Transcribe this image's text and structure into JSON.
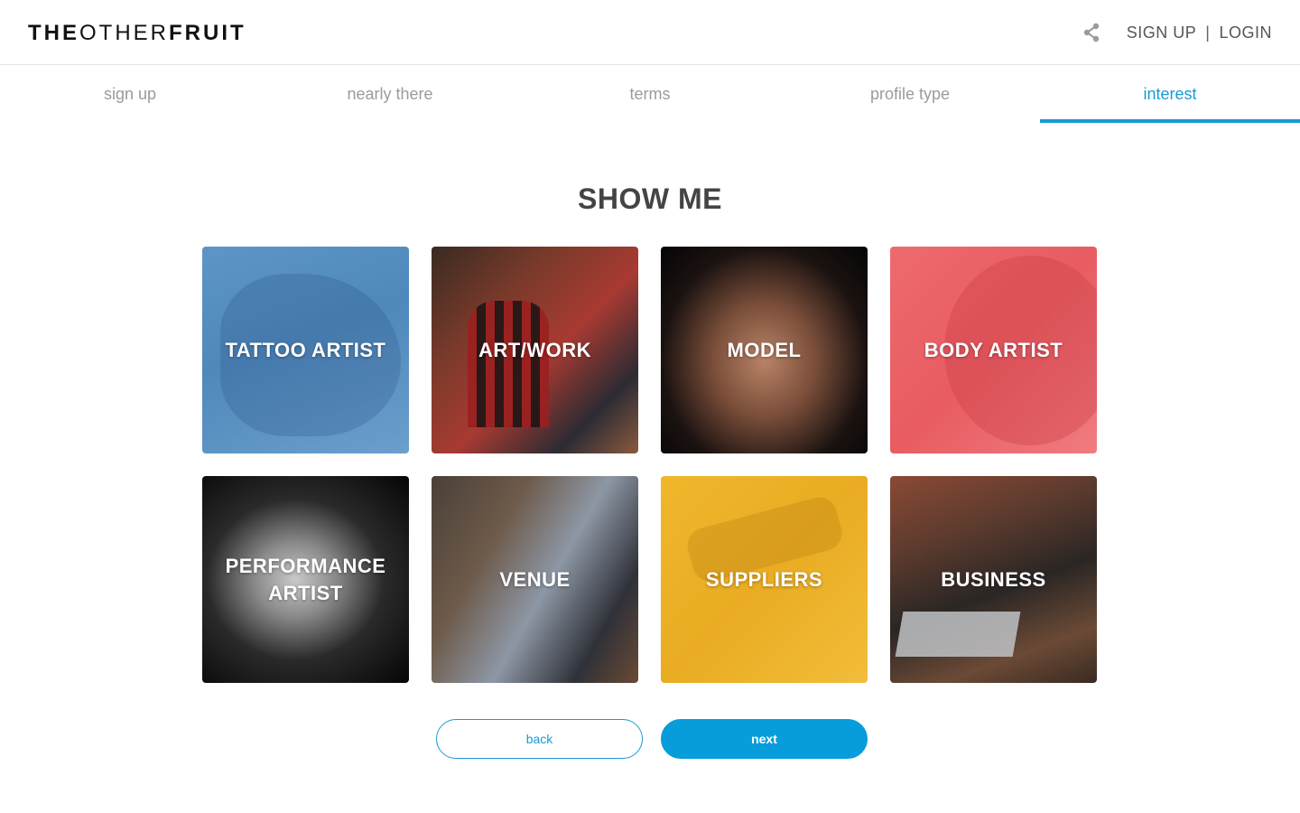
{
  "header": {
    "logo": {
      "part1": "THE",
      "part2": "OTHER",
      "part3": "FRUIT"
    },
    "share_icon": "share-icon",
    "signup_label": "SIGN UP",
    "separator": "|",
    "login_label": "LOGIN"
  },
  "steps": [
    {
      "label": "sign up",
      "active": false
    },
    {
      "label": "nearly there",
      "active": false
    },
    {
      "label": "terms",
      "active": false
    },
    {
      "label": "profile type",
      "active": false
    },
    {
      "label": "interest",
      "active": true
    }
  ],
  "main": {
    "title": "SHOW ME",
    "tiles": [
      {
        "label": "TATTOO ARTIST"
      },
      {
        "label": "ART/WORK"
      },
      {
        "label": "MODEL"
      },
      {
        "label": "BODY ARTIST"
      },
      {
        "label": "PERFORMANCE ARTIST"
      },
      {
        "label": "VENUE"
      },
      {
        "label": "SUPPLIERS"
      },
      {
        "label": "BUSINESS"
      }
    ]
  },
  "actions": {
    "back_label": "back",
    "next_label": "next"
  },
  "colors": {
    "accent": "#1a9ad6",
    "next_button": "#079ddb",
    "inactive_step": "#9b9b9b"
  }
}
